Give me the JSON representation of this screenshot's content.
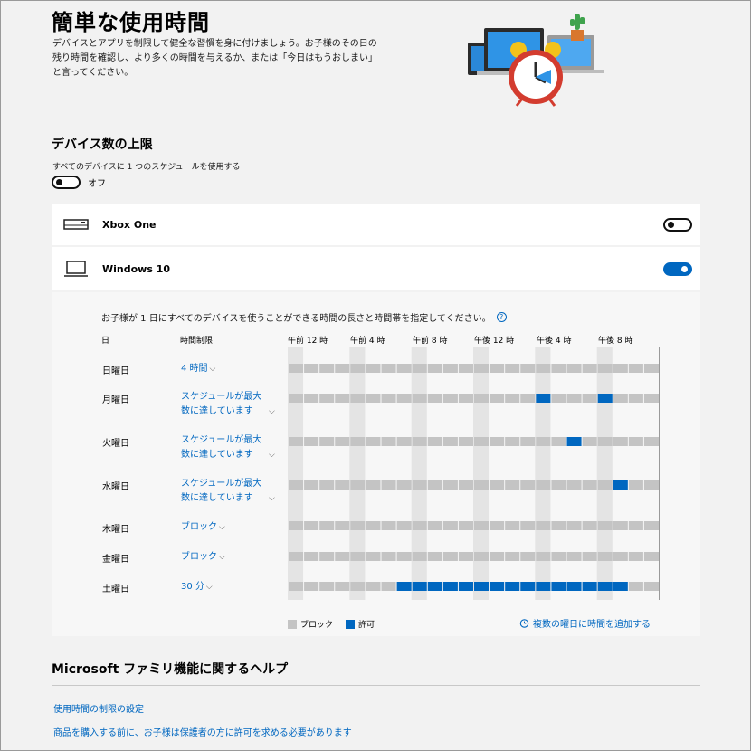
{
  "header": {
    "title": "簡単な使用時間",
    "description": "デバイスとアプリを制限して健全な習慣を身に付けましょう。お子様のその日の残り時間を確認し、より多くの時間を与えるか、または「今日はもうおしまい」と言ってください。"
  },
  "device_limits": {
    "title": "デバイス数の上限",
    "subtitle": "すべてのデバイスに 1 つのスケジュールを使用する",
    "toggle_state": "オフ"
  },
  "devices": [
    {
      "name": "Xbox One",
      "icon": "xbox-console-icon",
      "enabled": false
    },
    {
      "name": "Windows 10",
      "icon": "laptop-icon",
      "enabled": true
    }
  ],
  "schedule": {
    "description": "お子様が 1 日にすべてのデバイスを使うことができる時間の長さと時間帯を指定してください。",
    "help_icon": "?",
    "col_day": "日",
    "col_limit": "時間制限",
    "time_labels": [
      "午前 12 時",
      "午前 4 時",
      "午前 8 時",
      "午後 12 時",
      "午後 4 時",
      "午後 8 時"
    ],
    "slots_per_day": 24,
    "days": [
      {
        "day": "日曜日",
        "limit": "4 時間",
        "allowed": []
      },
      {
        "day": "月曜日",
        "limit": "スケジュールが最大数に達しています",
        "allowed": [
          16,
          20
        ]
      },
      {
        "day": "火曜日",
        "limit": "スケジュールが最大数に達しています",
        "allowed": [
          18
        ]
      },
      {
        "day": "水曜日",
        "limit": "スケジュールが最大数に達しています",
        "allowed": [
          21
        ]
      },
      {
        "day": "木曜日",
        "limit": "ブロック",
        "allowed": []
      },
      {
        "day": "金曜日",
        "limit": "ブロック",
        "allowed": []
      },
      {
        "day": "土曜日",
        "limit": "30 分",
        "allowed": [
          7,
          8,
          9,
          10,
          11,
          12,
          13,
          14,
          15,
          16,
          17,
          18,
          19,
          20,
          21
        ]
      }
    ],
    "legend_block": "ブロック",
    "legend_allow": "許可",
    "add_link": "複数の曜日に時間を追加する",
    "colors": {
      "block": "#c4c4c4",
      "allow": "#0067c0",
      "band": "#e4e4e4"
    }
  },
  "help": {
    "title": "Microsoft ファミリ機能に関するヘルプ",
    "links": [
      "使用時間の制限の設定",
      "商品を購入する前に、お子様は保護者の方に許可を求める必要があります"
    ]
  }
}
